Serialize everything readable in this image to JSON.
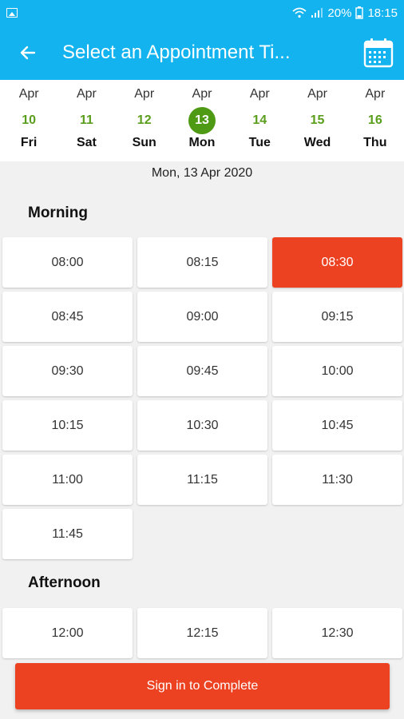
{
  "status": {
    "battery": "20%",
    "time": "18:15"
  },
  "header": {
    "title": "Select an Appointment Ti..."
  },
  "dates": [
    {
      "month": "Apr",
      "day": "10",
      "weekday": "Fri"
    },
    {
      "month": "Apr",
      "day": "11",
      "weekday": "Sat"
    },
    {
      "month": "Apr",
      "day": "12",
      "weekday": "Sun"
    },
    {
      "month": "Apr",
      "day": "13",
      "weekday": "Mon",
      "selected": true
    },
    {
      "month": "Apr",
      "day": "14",
      "weekday": "Tue"
    },
    {
      "month": "Apr",
      "day": "15",
      "weekday": "Wed"
    },
    {
      "month": "Apr",
      "day": "16",
      "weekday": "Thu"
    }
  ],
  "selected_date": "Mon, 13 Apr 2020",
  "morning": {
    "title": "Morning",
    "slots": [
      "08:00",
      "08:15",
      "08:30",
      "08:45",
      "09:00",
      "09:15",
      "09:30",
      "09:45",
      "10:00",
      "10:15",
      "10:30",
      "10:45",
      "11:00",
      "11:15",
      "11:30",
      "11:45"
    ]
  },
  "afternoon": {
    "title": "Afternoon",
    "slots": [
      "12:00",
      "12:15",
      "12:30"
    ]
  },
  "selected_slot": "08:30",
  "cta": {
    "label": "Sign in to Complete"
  },
  "colors": {
    "primary": "#12b3ee",
    "accent": "#ec4222",
    "date_green": "#4f9a14"
  }
}
